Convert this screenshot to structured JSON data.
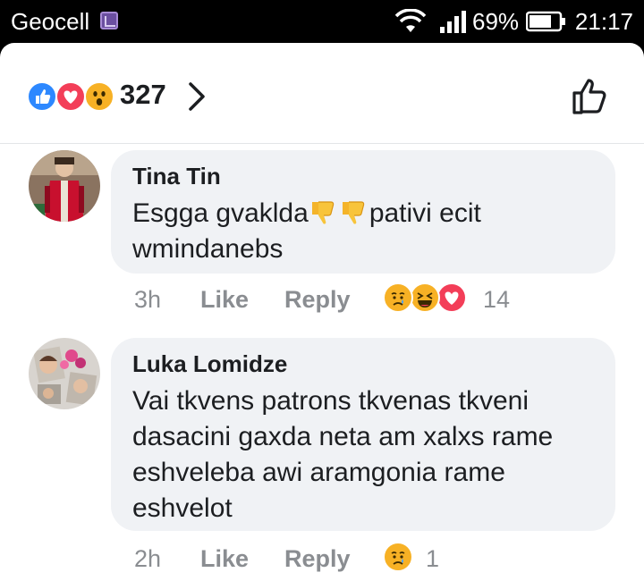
{
  "status_bar": {
    "carrier": "Geocell",
    "battery": "69%",
    "time": "21:17"
  },
  "reactions_header": {
    "count": "327",
    "icons": [
      "like-icon",
      "love-icon",
      "wow-icon"
    ]
  },
  "comments": [
    {
      "author": "Tina Tin",
      "text_before": "Esgga gvaklda",
      "text_after": "pativi ecit",
      "text_line2": "wmindanebs",
      "inline_emoji": [
        "thumbs-down-emoji",
        "thumbs-down-emoji"
      ],
      "time": "3h",
      "like_label": "Like",
      "reply_label": "Reply",
      "reaction_count": "14",
      "reactions": [
        "sad-icon",
        "haha-icon",
        "love-icon"
      ]
    },
    {
      "author": "Luka Lomidze",
      "lines": [
        "Vai tkvens patrons tkvenas tkveni",
        "dasacini gaxda neta am xalxs rame",
        "eshveleba awi aramgonia rame",
        "eshvelot"
      ],
      "time": "2h",
      "like_label": "Like",
      "reply_label": "Reply",
      "reaction_count": "1",
      "reactions": [
        "sad-icon"
      ]
    }
  ],
  "colors": {
    "like": "#2d88ff",
    "love": "#f33e58",
    "wow": "#f7b125",
    "bubble": "#f0f2f5",
    "meta": "#8a8d91"
  }
}
